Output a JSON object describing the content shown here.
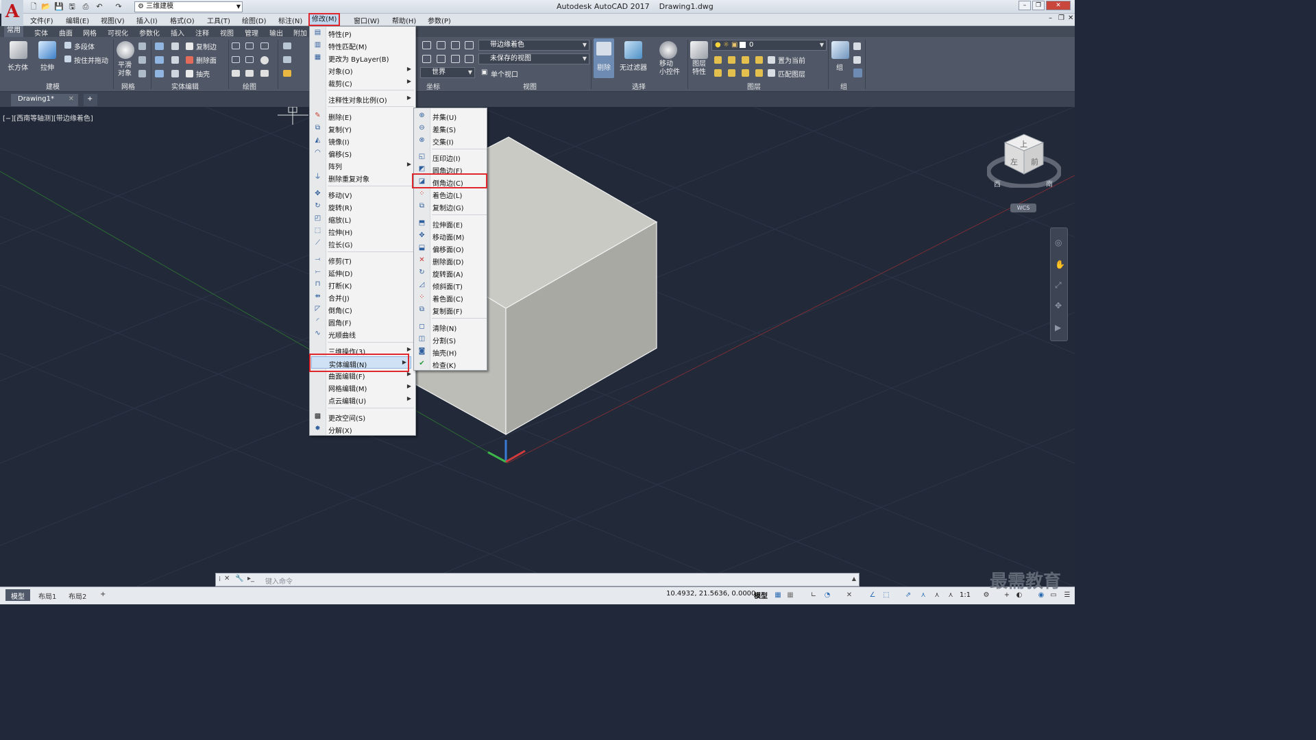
{
  "titlebar": {
    "workspace": "三维建模",
    "app_title": "Autodesk AutoCAD 2017",
    "file_title": "Drawing1.dwg"
  },
  "menubar": [
    {
      "label": "文件(F)"
    },
    {
      "label": "编辑(E)"
    },
    {
      "label": "视图(V)"
    },
    {
      "label": "插入(I)"
    },
    {
      "label": "格式(O)"
    },
    {
      "label": "工具(T)"
    },
    {
      "label": "绘图(D)"
    },
    {
      "label": "标注(N)"
    },
    {
      "label": "修改(M)"
    },
    {
      "label": "窗口(W)"
    },
    {
      "label": "帮助(H)"
    },
    {
      "label": "参数(P)"
    }
  ],
  "ribbon_tabs": [
    "常用",
    "实体",
    "曲面",
    "网格",
    "可视化",
    "参数化",
    "插入",
    "注释",
    "视图",
    "管理",
    "输出",
    "附加"
  ],
  "ribbon": {
    "box": "长方体",
    "extrude": "拉伸",
    "polysolid": "多段体",
    "presspull": "按住并拖动",
    "smooth": "平滑\n对象",
    "copy_edge": "复制边",
    "delete_face": "删除面",
    "shell": "抽壳",
    "visual_style": "带边缘着色",
    "saved_view": "未保存的视图",
    "ucs": "世界",
    "viewport": "单个视口",
    "cull": "剔除",
    "no_filter": "无过滤器",
    "move_gizmo": "移动\n小控件",
    "layer_props": "图层\n特性",
    "layer_name": "0",
    "set_current": "置为当前",
    "match_layer": "匹配图层",
    "group": "组",
    "groups": {
      "modeling": "建模",
      "mesh": "网格",
      "solid_edit": "实体编辑",
      "draw": "绘图",
      "coords": "坐标",
      "view": "视图",
      "selection": "选择",
      "layers": "图层",
      "groups": "组"
    }
  },
  "doc_tab": "Drawing1*",
  "view_label": "[−][西南等轴测][带边缘着色]",
  "viewcube": {
    "top": "上",
    "left": "左",
    "front": "前",
    "west": "西",
    "south": "南",
    "wcs": "WCS"
  },
  "modify_menu": [
    {
      "label": "特性(P)",
      "icon": "properties-icon"
    },
    {
      "label": "特性匹配(M)",
      "icon": "match-prop-icon"
    },
    {
      "label": "更改为 ByLayer(B)",
      "icon": "bylayer-icon"
    },
    {
      "label": "对象(O)",
      "submenu": true
    },
    {
      "label": "裁剪(C)",
      "submenu": true
    },
    {
      "label": "注释性对象比例(O)",
      "submenu": true
    },
    {
      "label": "删除(E)",
      "icon": "erase-icon"
    },
    {
      "label": "复制(Y)",
      "icon": "copy-icon"
    },
    {
      "label": "镜像(I)",
      "icon": "mirror-icon"
    },
    {
      "label": "偏移(S)",
      "icon": "offset-icon"
    },
    {
      "label": "阵列",
      "submenu": true
    },
    {
      "label": "删除重复对象",
      "icon": "overkill-icon"
    },
    {
      "label": "移动(V)",
      "icon": "move-icon"
    },
    {
      "label": "旋转(R)",
      "icon": "rotate-icon"
    },
    {
      "label": "缩放(L)",
      "icon": "scale-icon"
    },
    {
      "label": "拉伸(H)",
      "icon": "stretch-icon"
    },
    {
      "label": "拉长(G)",
      "icon": "lengthen-icon"
    },
    {
      "label": "修剪(T)",
      "icon": "trim-icon"
    },
    {
      "label": "延伸(D)",
      "icon": "extend-icon"
    },
    {
      "label": "打断(K)",
      "icon": "break-icon"
    },
    {
      "label": "合并(J)",
      "icon": "join-icon"
    },
    {
      "label": "倒角(C)",
      "icon": "chamfer-icon"
    },
    {
      "label": "圆角(F)",
      "icon": "fillet-icon"
    },
    {
      "label": "光顺曲线",
      "icon": "blend-icon"
    },
    {
      "label": "三维操作(3)",
      "submenu": true
    },
    {
      "label": "实体编辑(N)",
      "submenu": true
    },
    {
      "label": "曲面编辑(F)",
      "submenu": true
    },
    {
      "label": "网格编辑(M)",
      "submenu": true
    },
    {
      "label": "点云编辑(U)",
      "submenu": true
    },
    {
      "label": "更改空间(S)",
      "icon": "chspace-icon"
    },
    {
      "label": "分解(X)",
      "icon": "explode-icon"
    }
  ],
  "solid_edit_menu": [
    {
      "label": "并集(U)"
    },
    {
      "label": "差集(S)"
    },
    {
      "label": "交集(I)"
    },
    {
      "label": "压印边(I)"
    },
    {
      "label": "圆角边(F)"
    },
    {
      "label": "倒角边(C)"
    },
    {
      "label": "着色边(L)"
    },
    {
      "label": "复制边(G)"
    },
    {
      "label": "拉伸面(E)"
    },
    {
      "label": "移动面(M)"
    },
    {
      "label": "偏移面(O)"
    },
    {
      "label": "删除面(D)"
    },
    {
      "label": "旋转面(A)"
    },
    {
      "label": "倾斜面(T)"
    },
    {
      "label": "着色面(C)"
    },
    {
      "label": "复制面(F)"
    },
    {
      "label": "清除(N)"
    },
    {
      "label": "分割(S)"
    },
    {
      "label": "抽壳(H)"
    },
    {
      "label": "检查(K)"
    }
  ],
  "command_line": {
    "placeholder": "键入命令"
  },
  "status": {
    "tabs": [
      "模型",
      "布局1",
      "布局2"
    ],
    "coords": "10.4932, 21.5636, 0.0000",
    "model": "模型",
    "scale": "1:1"
  },
  "watermark": "最需教育",
  "colors": {
    "highlight_box": "#e0262d",
    "drawing_bg": "#222a3a",
    "cube_top": "#c9c9c4",
    "cube_left": "#bdbdb8",
    "cube_right": "#a8a8a3"
  }
}
